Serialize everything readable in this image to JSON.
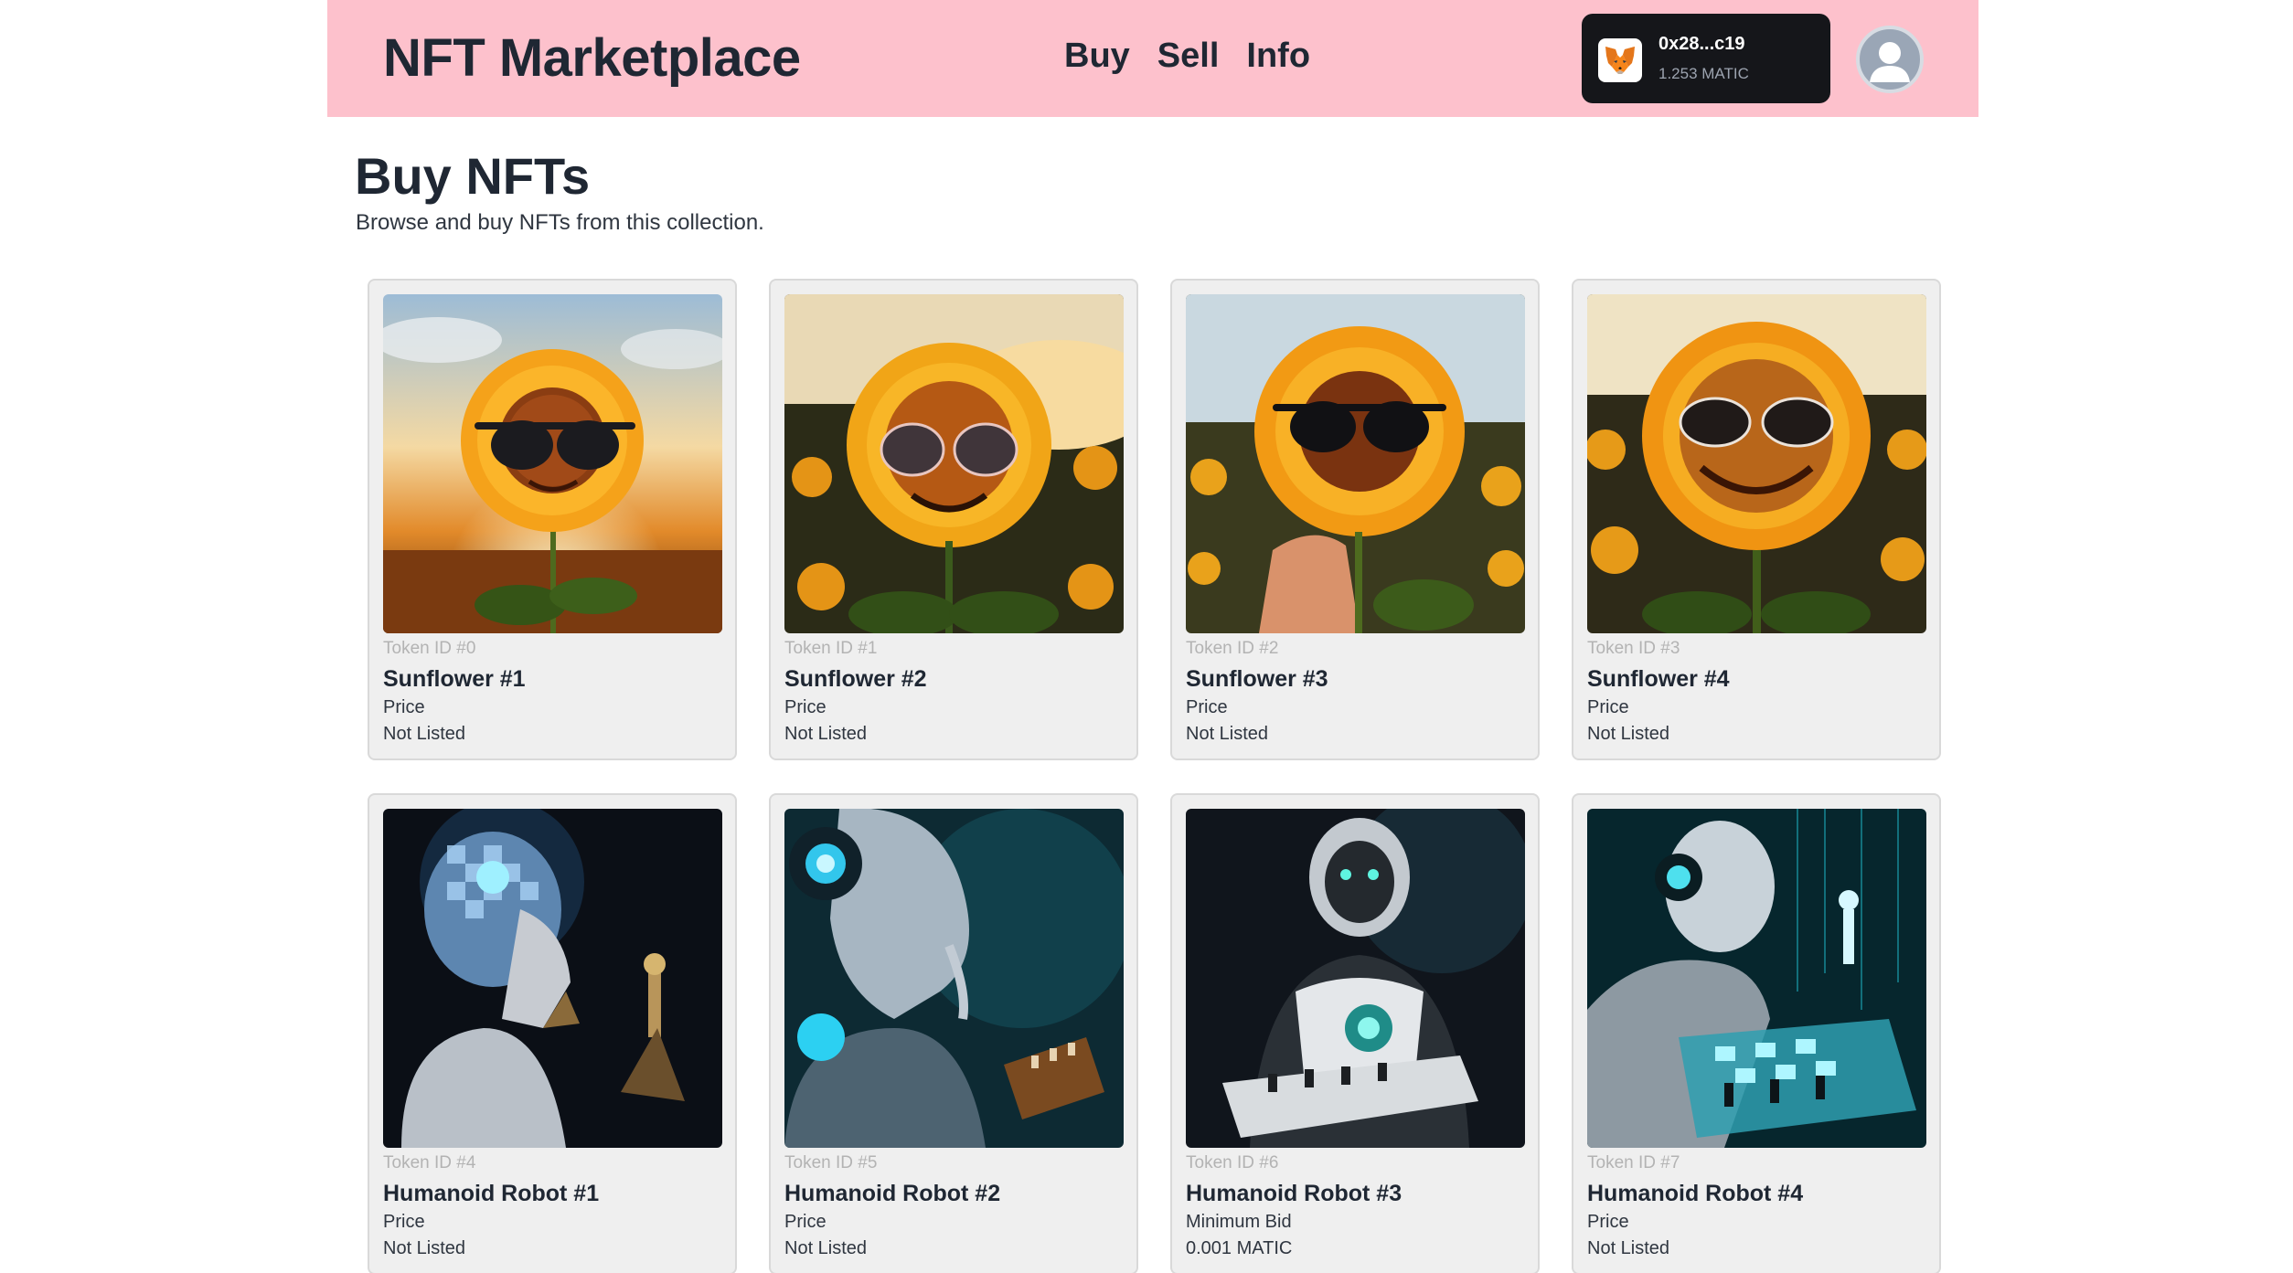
{
  "header": {
    "brand": "NFT Marketplace",
    "nav": [
      "Buy",
      "Sell",
      "Info"
    ],
    "wallet": {
      "address": "0x28...c19",
      "balance": "1.253 MATIC",
      "icon": "metamask-fox-icon"
    },
    "avatar_icon": "user-avatar-icon",
    "background_color": "#fdc1cc"
  },
  "page": {
    "title": "Buy NFTs",
    "subtitle": "Browse and buy NFTs from this collection."
  },
  "nfts": [
    {
      "token_id": "Token ID #0",
      "name": "Sunflower #1",
      "price_label": "Price",
      "price_value": "Not Listed",
      "image": "sunflower-sunglasses-sunset"
    },
    {
      "token_id": "Token ID #1",
      "name": "Sunflower #2",
      "price_label": "Price",
      "price_value": "Not Listed",
      "image": "sunflower-smiling-field"
    },
    {
      "token_id": "Token ID #2",
      "name": "Sunflower #3",
      "price_label": "Price",
      "price_value": "Not Listed",
      "image": "sunflower-held-in-hand"
    },
    {
      "token_id": "Token ID #3",
      "name": "Sunflower #4",
      "price_label": "Price",
      "price_value": "Not Listed",
      "image": "sunflower-grinning-field"
    },
    {
      "token_id": "Token ID #4",
      "name": "Humanoid Robot #1",
      "price_label": "Price",
      "price_value": "Not Listed",
      "image": "robot-chess-brain"
    },
    {
      "token_id": "Token ID #5",
      "name": "Humanoid Robot #2",
      "price_label": "Price",
      "price_value": "Not Listed",
      "image": "robot-thinking-chessboard"
    },
    {
      "token_id": "Token ID #6",
      "name": "Humanoid Robot #3",
      "price_label": "Minimum Bid",
      "price_value": "0.001 MATIC",
      "image": "robot-holding-chessboard"
    },
    {
      "token_id": "Token ID #7",
      "name": "Humanoid Robot #4",
      "price_label": "Price",
      "price_value": "Not Listed",
      "image": "robot-glowing-chessboard"
    }
  ]
}
